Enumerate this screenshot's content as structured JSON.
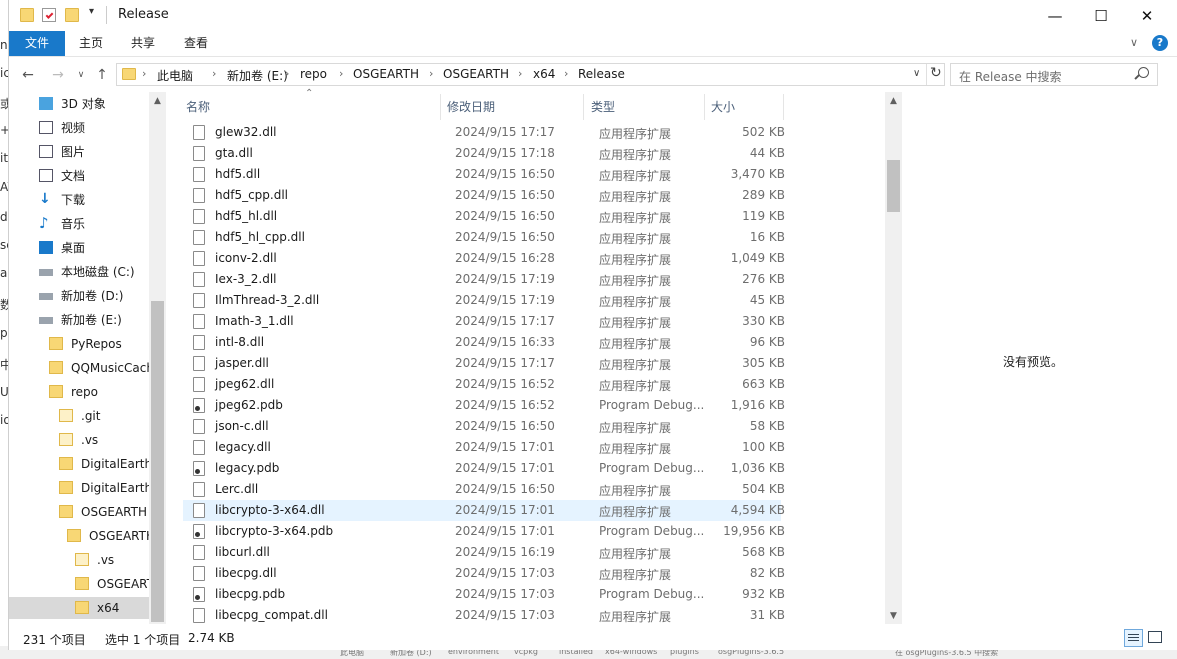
{
  "window": {
    "title": "Release",
    "minimize": "—",
    "maximize": "☐",
    "close": "✕"
  },
  "ribbon": {
    "tabs": [
      "文件",
      "主页",
      "共享",
      "查看"
    ]
  },
  "address": {
    "crumbs": [
      "此电脑",
      "新加卷 (E:)",
      "repo",
      "OSGEARTH",
      "OSGEARTH",
      "x64",
      "Release"
    ],
    "search_placeholder": "在 Release 中搜索"
  },
  "nav": {
    "items": [
      {
        "label": "3D 对象",
        "icon": "3d-objects-icon"
      },
      {
        "label": "视频",
        "icon": "video-icon"
      },
      {
        "label": "图片",
        "icon": "pictures-icon"
      },
      {
        "label": "文档",
        "icon": "documents-icon"
      },
      {
        "label": "下载",
        "icon": "download-icon"
      },
      {
        "label": "音乐",
        "icon": "music-icon"
      },
      {
        "label": "桌面",
        "icon": "desktop-icon"
      },
      {
        "label": "本地磁盘 (C:)",
        "icon": "drive-icon"
      },
      {
        "label": "新加卷 (D:)",
        "icon": "drive-icon"
      },
      {
        "label": "新加卷 (E:)",
        "icon": "drive-icon"
      },
      {
        "label": "PyRepos",
        "icon": "folder-icon"
      },
      {
        "label": "QQMusicCach",
        "icon": "folder-icon"
      },
      {
        "label": "repo",
        "icon": "folder-icon"
      },
      {
        "label": ".git",
        "icon": "folder-icon"
      },
      {
        "label": ".vs",
        "icon": "folder-icon"
      },
      {
        "label": "DigitalEarth",
        "icon": "folder-icon"
      },
      {
        "label": "DigitalEarthT",
        "icon": "folder-icon"
      },
      {
        "label": "OSGEARTH",
        "icon": "folder-icon"
      },
      {
        "label": "OSGEARTH",
        "icon": "folder-icon"
      },
      {
        "label": ".vs",
        "icon": "folder-icon"
      },
      {
        "label": "OSGEART",
        "icon": "folder-icon"
      },
      {
        "label": "x64",
        "icon": "folder-icon"
      }
    ]
  },
  "columns": {
    "name": "名称",
    "date": "修改日期",
    "type": "类型",
    "size": "大小"
  },
  "files": [
    {
      "name": "glew32.dll",
      "date": "2024/9/15 17:17",
      "type": "应用程序扩展",
      "size": "502 KB"
    },
    {
      "name": "gta.dll",
      "date": "2024/9/15 17:18",
      "type": "应用程序扩展",
      "size": "44 KB"
    },
    {
      "name": "hdf5.dll",
      "date": "2024/9/15 16:50",
      "type": "应用程序扩展",
      "size": "3,470 KB"
    },
    {
      "name": "hdf5_cpp.dll",
      "date": "2024/9/15 16:50",
      "type": "应用程序扩展",
      "size": "289 KB"
    },
    {
      "name": "hdf5_hl.dll",
      "date": "2024/9/15 16:50",
      "type": "应用程序扩展",
      "size": "119 KB"
    },
    {
      "name": "hdf5_hl_cpp.dll",
      "date": "2024/9/15 16:50",
      "type": "应用程序扩展",
      "size": "16 KB"
    },
    {
      "name": "iconv-2.dll",
      "date": "2024/9/15 16:28",
      "type": "应用程序扩展",
      "size": "1,049 KB"
    },
    {
      "name": "Iex-3_2.dll",
      "date": "2024/9/15 17:19",
      "type": "应用程序扩展",
      "size": "276 KB"
    },
    {
      "name": "IlmThread-3_2.dll",
      "date": "2024/9/15 17:19",
      "type": "应用程序扩展",
      "size": "45 KB"
    },
    {
      "name": "Imath-3_1.dll",
      "date": "2024/9/15 17:17",
      "type": "应用程序扩展",
      "size": "330 KB"
    },
    {
      "name": "intl-8.dll",
      "date": "2024/9/15 16:33",
      "type": "应用程序扩展",
      "size": "96 KB"
    },
    {
      "name": "jasper.dll",
      "date": "2024/9/15 17:17",
      "type": "应用程序扩展",
      "size": "305 KB"
    },
    {
      "name": "jpeg62.dll",
      "date": "2024/9/15 16:52",
      "type": "应用程序扩展",
      "size": "663 KB"
    },
    {
      "name": "jpeg62.pdb",
      "date": "2024/9/15 16:52",
      "type": "Program Debug...",
      "size": "1,916 KB"
    },
    {
      "name": "json-c.dll",
      "date": "2024/9/15 16:50",
      "type": "应用程序扩展",
      "size": "58 KB"
    },
    {
      "name": "legacy.dll",
      "date": "2024/9/15 17:01",
      "type": "应用程序扩展",
      "size": "100 KB"
    },
    {
      "name": "legacy.pdb",
      "date": "2024/9/15 17:01",
      "type": "Program Debug...",
      "size": "1,036 KB"
    },
    {
      "name": "Lerc.dll",
      "date": "2024/9/15 16:50",
      "type": "应用程序扩展",
      "size": "504 KB"
    },
    {
      "name": "libcrypto-3-x64.dll",
      "date": "2024/9/15 17:01",
      "type": "应用程序扩展",
      "size": "4,594 KB"
    },
    {
      "name": "libcrypto-3-x64.pdb",
      "date": "2024/9/15 17:01",
      "type": "Program Debug...",
      "size": "19,956 KB"
    },
    {
      "name": "libcurl.dll",
      "date": "2024/9/15 16:19",
      "type": "应用程序扩展",
      "size": "568 KB"
    },
    {
      "name": "libecpg.dll",
      "date": "2024/9/15 17:03",
      "type": "应用程序扩展",
      "size": "82 KB"
    },
    {
      "name": "libecpg.pdb",
      "date": "2024/9/15 17:03",
      "type": "Program Debug...",
      "size": "932 KB"
    },
    {
      "name": "libecpg_compat.dll",
      "date": "2024/9/15 17:03",
      "type": "应用程序扩展",
      "size": "31 KB"
    }
  ],
  "selected_file": "libcrypto-3-x64.dll",
  "preview": {
    "text": "没有预览。"
  },
  "status": {
    "count": "231 个项目",
    "selection": "选中 1 个项目",
    "size": "2.74 KB"
  },
  "background_fragments": {
    "left": [
      "n",
      "ic",
      "或",
      "+",
      "it",
      "AV",
      "dy",
      "sc",
      "as",
      "数",
      "p",
      "中",
      "U",
      "io"
    ],
    "bottom": [
      "此电脑",
      "新加卷 (D:)",
      "environment",
      "vcpkg",
      "installed",
      "x64-windows",
      "plugins",
      "osgPlugins-3.6.5",
      "在 osgPlugins-3.6.5 中搜索"
    ]
  },
  "colors": {
    "accent": "#1979ca",
    "selection": "#e5f3ff",
    "folder": "#f8d775"
  }
}
